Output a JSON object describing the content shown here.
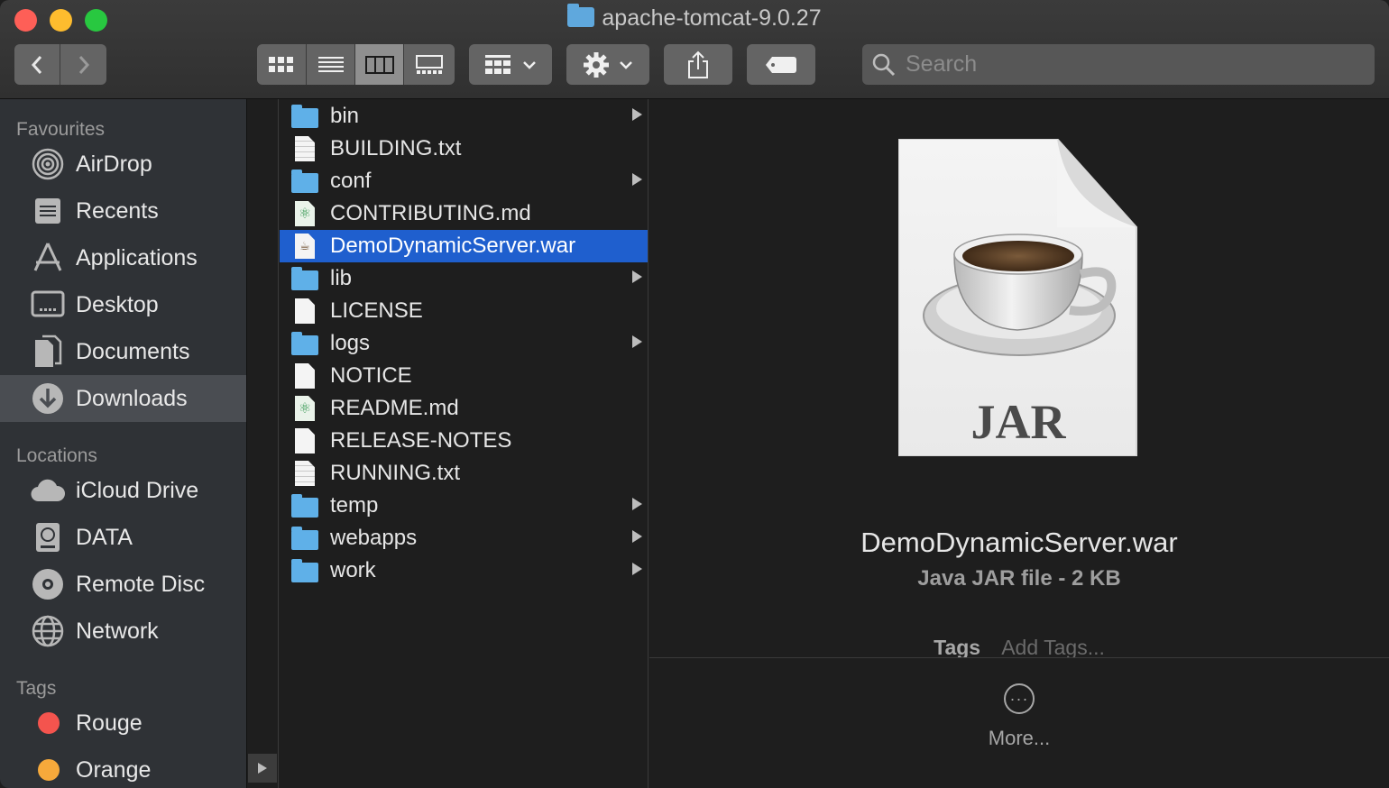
{
  "window": {
    "title": "apache-tomcat-9.0.27"
  },
  "toolbar": {
    "back_icon": "chevron-left-icon",
    "forward_icon": "chevron-right-icon",
    "view_modes": [
      "icon-view-icon",
      "list-view-icon",
      "column-view-icon",
      "gallery-view-icon"
    ],
    "active_view": "column",
    "group_icon": "group-by-icon",
    "action_icon": "gear-icon",
    "share_icon": "share-icon",
    "tag_icon": "tag-icon",
    "search_placeholder": "Search"
  },
  "sidebar": {
    "favourites_header": "Favourites",
    "favourites": [
      {
        "label": "AirDrop",
        "icon": "airdrop-icon"
      },
      {
        "label": "Recents",
        "icon": "recents-icon"
      },
      {
        "label": "Applications",
        "icon": "applications-icon"
      },
      {
        "label": "Desktop",
        "icon": "desktop-icon"
      },
      {
        "label": "Documents",
        "icon": "documents-icon"
      },
      {
        "label": "Downloads",
        "icon": "downloads-icon",
        "selected": true
      }
    ],
    "locations_header": "Locations",
    "locations": [
      {
        "label": "iCloud Drive",
        "icon": "cloud-icon"
      },
      {
        "label": "DATA",
        "icon": "disk-icon"
      },
      {
        "label": "Remote Disc",
        "icon": "disc-icon"
      },
      {
        "label": "Network",
        "icon": "network-icon"
      }
    ],
    "tags_header": "Tags",
    "tags": [
      {
        "label": "Rouge",
        "color": "#f4544e"
      },
      {
        "label": "Orange",
        "color": "#f6a93b"
      }
    ]
  },
  "files": [
    {
      "name": "bin",
      "type": "folder"
    },
    {
      "name": "BUILDING.txt",
      "type": "text"
    },
    {
      "name": "conf",
      "type": "folder"
    },
    {
      "name": "CONTRIBUTING.md",
      "type": "markdown"
    },
    {
      "name": "DemoDynamicServer.war",
      "type": "jar",
      "selected": true
    },
    {
      "name": "lib",
      "type": "folder"
    },
    {
      "name": "LICENSE",
      "type": "document"
    },
    {
      "name": "logs",
      "type": "folder"
    },
    {
      "name": "NOTICE",
      "type": "document"
    },
    {
      "name": "README.md",
      "type": "markdown"
    },
    {
      "name": "RELEASE-NOTES",
      "type": "document"
    },
    {
      "name": "RUNNING.txt",
      "type": "text"
    },
    {
      "name": "temp",
      "type": "folder"
    },
    {
      "name": "webapps",
      "type": "folder"
    },
    {
      "name": "work",
      "type": "folder"
    }
  ],
  "preview": {
    "icon_label": "JAR",
    "name": "DemoDynamicServer.war",
    "info": "Java JAR file - 2 KB",
    "tags_label": "Tags",
    "tags_placeholder": "Add Tags...",
    "more_label": "More..."
  },
  "colors": {
    "selection": "#1f5fce",
    "folder": "#5fb0e8"
  }
}
